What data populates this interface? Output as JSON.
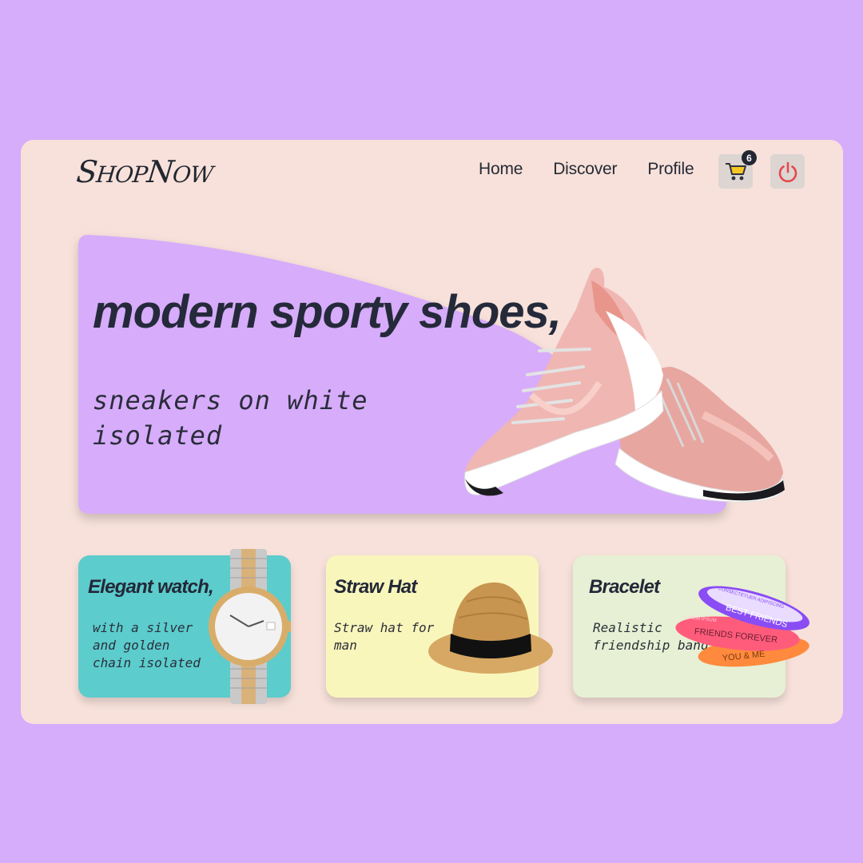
{
  "brand": {
    "name_first": "S",
    "name_rest_1": "HOP",
    "name_mid": "N",
    "name_rest_2": "OW"
  },
  "nav": {
    "items": [
      {
        "label": "Home"
      },
      {
        "label": "Discover"
      },
      {
        "label": "Profile"
      }
    ]
  },
  "cart": {
    "count": "6",
    "icon": "cart-icon"
  },
  "power": {
    "icon": "power-icon"
  },
  "hero": {
    "title": "modern sporty shoes,",
    "subtitle": "sneakers on white isolated"
  },
  "cards": [
    {
      "title": "Elegant watch,",
      "description": "with a silver and golden chain isolated",
      "image": "watch"
    },
    {
      "title": "Straw Hat",
      "description": "Straw hat for man",
      "image": "straw-hat"
    },
    {
      "title": "Bracelet",
      "description": "Realistic friendship band",
      "image": "bracelets",
      "band_texts": [
        "CONSECTETUER ADIPISCING",
        "BEST FRIENDS",
        "LOREM IPSUM",
        "FRIENDS FOREVER",
        "YOU & ME"
      ]
    }
  ],
  "colors": {
    "background": "#d6adfb",
    "frame": "#f7e1da",
    "hero": "#d7acfb",
    "card_watch": "#5ccccd",
    "card_hat": "#f9f6bb",
    "card_bracelet": "#e7f0d4",
    "text_dark": "#252a3a",
    "power_red": "#e5484d",
    "cart_yellow": "#f6c624"
  }
}
